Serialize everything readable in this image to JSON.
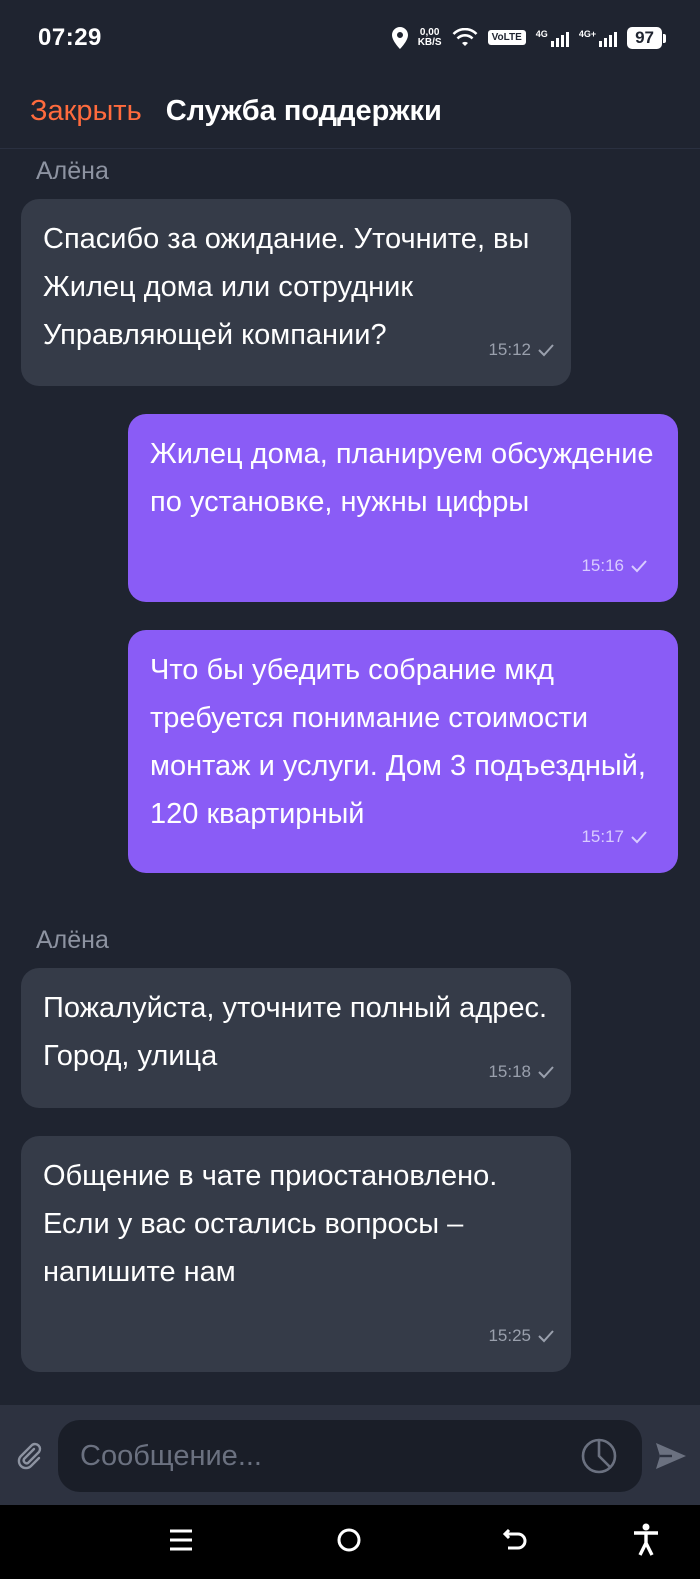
{
  "status_bar": {
    "time": "07:29",
    "net_speed_value": "0,00",
    "net_speed_unit": "KB/S",
    "volte": "VoLTE",
    "sim1_label": "4G",
    "sim2_label": "4G+",
    "battery": "97"
  },
  "header": {
    "close_label": "Закрыть",
    "title": "Служба поддержки"
  },
  "messages": [
    {
      "sender": "Алёна",
      "direction": "in",
      "text": "Спасибо за ожидание. Уточните, вы Жилец дома или сотрудник Управляющей компании?",
      "time": "15:12"
    },
    {
      "direction": "out",
      "text": "Жилец дома, планируем обсуждение по установке, нужны цифры",
      "time": "15:16"
    },
    {
      "direction": "out",
      "text": "Что бы убедить собрание мкд требуется понимание стоимости монтаж и услуги. Дом 3 подъездный, 120 квартирный",
      "time": "15:17"
    },
    {
      "sender": "Алёна",
      "direction": "in",
      "text": "Пожалуйста, уточните полный адрес. Город, улица",
      "time": "15:18"
    },
    {
      "direction": "in",
      "text": "Общение в чате приостановлено. Если у вас остались вопросы – напишите нам",
      "time": "15:25"
    }
  ],
  "composer": {
    "placeholder": "Сообщение..."
  },
  "colors": {
    "background": "#1f2430",
    "incoming_bubble": "#353b48",
    "outgoing_bubble": "#8a5cf6",
    "accent": "#ff6b3d"
  }
}
